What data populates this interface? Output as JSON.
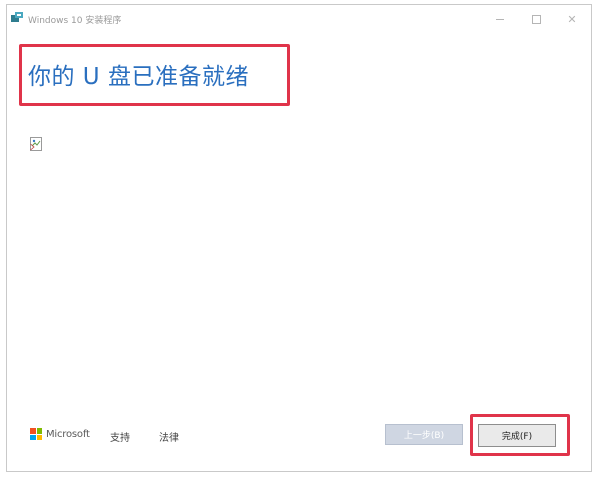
{
  "window": {
    "title": "Windows 10 安装程序",
    "close_glyph": "✕"
  },
  "main": {
    "heading": "你的 U 盘已准备就绪"
  },
  "footer": {
    "brand": "Microsoft",
    "support_link": "支持",
    "legal_link": "法律",
    "back_button": "上一步(B)",
    "finish_button": "完成(F)"
  },
  "colors": {
    "heading_blue": "#2a6fbf",
    "highlight_red": "#e0344a",
    "ms_red": "#f25022",
    "ms_green": "#7fba00",
    "ms_blue": "#00a4ef",
    "ms_yellow": "#ffb900",
    "disabled_button": "#cfd6e2"
  },
  "icons": {
    "app": "setup-icon",
    "image": "broken-image-icon",
    "logo": "microsoft-logo-icon"
  }
}
